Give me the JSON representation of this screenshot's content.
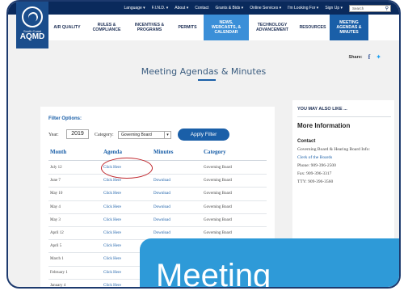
{
  "topbar": {
    "items": [
      "Language ▾",
      "F.I.N.D. ▾",
      "About ▾",
      "Contact",
      "Grants & Bids ▾",
      "Online Services ▾",
      "I'm Looking For ▾",
      "Sign Up ▾"
    ],
    "search_placeholder": "Search"
  },
  "logo": {
    "subtitle": "South Coast",
    "name": "AQMD"
  },
  "nav": {
    "items": [
      "AIR QUALITY",
      "RULES & COMPLIANCE",
      "INCENTIVES & PROGRAMS",
      "PERMITS",
      "NEWS, WEBCASTS, & CALENDAR",
      "TECHNOLOGY ADVANCEMENT",
      "RESOURCES",
      "MEETING AGENDAS & MINUTES"
    ]
  },
  "share": {
    "label": "Share:"
  },
  "page": {
    "title": "Meeting Agendas & Minutes"
  },
  "filter": {
    "heading": "Filter Options:",
    "year_label": "Year:",
    "year_value": "2019",
    "category_label": "Category:",
    "category_value": "Governing Board",
    "apply_label": "Apply Filter"
  },
  "table": {
    "headers": [
      "Month",
      "Agenda",
      "Minutes",
      "Category"
    ],
    "rows": [
      {
        "month": "July 12",
        "agenda": "Click Here",
        "minutes": "",
        "category": "Governing Board"
      },
      {
        "month": "June 7",
        "agenda": "Click Here",
        "minutes": "Download",
        "category": "Governing Board"
      },
      {
        "month": "May 10",
        "agenda": "Click Here",
        "minutes": "Download",
        "category": "Governing Board"
      },
      {
        "month": "May 4",
        "agenda": "Click Here",
        "minutes": "Download",
        "category": "Governing Board"
      },
      {
        "month": "May 3",
        "agenda": "Click Here",
        "minutes": "Download",
        "category": "Governing Board"
      },
      {
        "month": "April 12",
        "agenda": "Click Here",
        "minutes": "Download",
        "category": "Governing Board"
      },
      {
        "month": "April 5",
        "agenda": "Click Here",
        "minutes": "",
        "category": ""
      },
      {
        "month": "March 1",
        "agenda": "Click Here",
        "minutes": "",
        "category": ""
      },
      {
        "month": "February 1",
        "agenda": "Click Here",
        "minutes": "",
        "category": ""
      },
      {
        "month": "January 4",
        "agenda": "Click Here",
        "minutes": "",
        "category": ""
      }
    ]
  },
  "sidebar": {
    "also_heading": "YOU MAY ALSO LIKE ...",
    "more_info": "More Information",
    "contact_heading": "Contact",
    "contact_line1": "Governing Board & Hearing Board Info:",
    "contact_link": "Clerk of the Boards",
    "phone": "Phone: 909-396-2500",
    "fax": "Fax: 909-396-3317",
    "tty": "TTY: 909-396-3560"
  },
  "overlay": {
    "text": "Meeting"
  },
  "colors": {
    "brand_navy": "#0a2a5c",
    "accent_blue": "#1a5fa8",
    "highlight_circle": "#c0272d",
    "overlay_blue": "#2e9ad8"
  }
}
